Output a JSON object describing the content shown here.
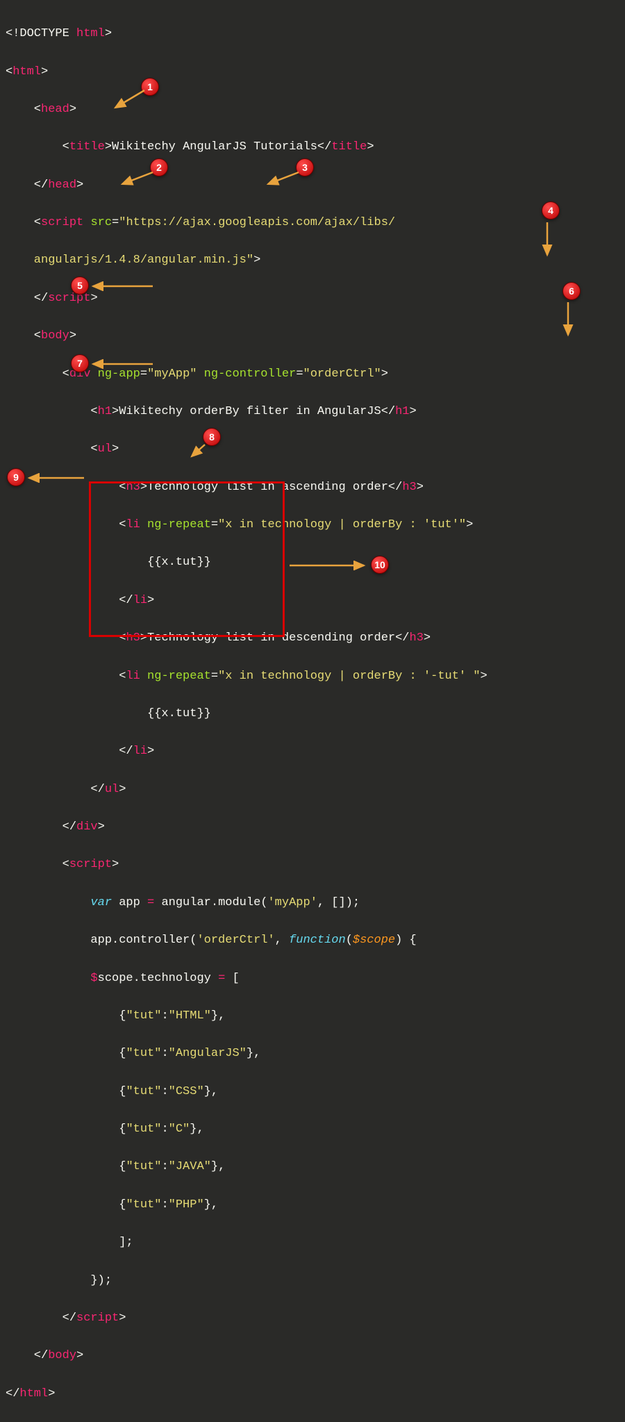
{
  "badges": {
    "b1": "1",
    "b2": "2",
    "b3": "3",
    "b4": "4",
    "b5": "5",
    "b6": "6",
    "b7": "7",
    "b8": "8",
    "b9": "9",
    "b10": "10"
  },
  "code": {
    "l1_a": "<!DOCTYPE ",
    "l1_b": "html",
    "l1_c": ">",
    "l2_a": "<",
    "l2_b": "html",
    "l2_c": ">",
    "l3_a": "    <",
    "l3_b": "head",
    "l3_c": ">",
    "l4_a": "        <",
    "l4_b": "title",
    "l4_c": ">",
    "l4_d": "Wikitechy AngularJS Tutorials",
    "l4_e": "</",
    "l4_f": "title",
    "l4_g": ">",
    "l5_a": "    </",
    "l5_b": "head",
    "l5_c": ">",
    "l6_a": "    <",
    "l6_b": "script ",
    "l6_c": "src",
    "l6_d": "=",
    "l6_e": "\"https://ajax.googleapis.com/ajax/libs/",
    "l7_a": "    angularjs/1.4.8/angular.min.js\"",
    "l7_b": ">",
    "l8_a": "    </",
    "l8_b": "script",
    "l8_c": ">",
    "l9_a": "    <",
    "l9_b": "body",
    "l9_c": ">",
    "l10_a": "        <",
    "l10_b": "div ",
    "l10_c": "ng-app",
    "l10_d": "=",
    "l10_e": "\"myApp\"",
    "l10_f": " ng-controller",
    "l10_g": "=",
    "l10_h": "\"orderCtrl\"",
    "l10_i": ">",
    "l11_a": "            <",
    "l11_b": "h1",
    "l11_c": ">",
    "l11_d": "Wikitechy orderBy filter in AngularJS",
    "l11_e": "</",
    "l11_f": "h1",
    "l11_g": ">",
    "l12_a": "            <",
    "l12_b": "ul",
    "l12_c": ">",
    "l13_a": "                <",
    "l13_b": "h3",
    "l13_c": ">",
    "l13_d": "Technology list in ascending order",
    "l13_e": "</",
    "l13_f": "h3",
    "l13_g": ">",
    "l14_a": "                <",
    "l14_b": "li ",
    "l14_c": "ng-repeat",
    "l14_d": "=",
    "l14_e": "\"x in technology | orderBy : 'tut'\"",
    "l14_f": ">",
    "l15_a": "                    {{x.tut}}",
    "l16_a": "                </",
    "l16_b": "li",
    "l16_c": ">",
    "l17_a": "                <",
    "l17_b": "h3",
    "l17_c": ">",
    "l17_d": "Technology list in descending order",
    "l17_e": "</",
    "l17_f": "h3",
    "l17_g": ">",
    "l18_a": "                <",
    "l18_b": "li ",
    "l18_c": "ng-repeat",
    "l18_d": "=",
    "l18_e": "\"x in technology | orderBy : '-tut' \"",
    "l18_f": ">",
    "l19_a": "                    {{x.tut}}",
    "l20_a": "                </",
    "l20_b": "li",
    "l20_c": ">",
    "l21_a": "            </",
    "l21_b": "ul",
    "l21_c": ">",
    "l22_a": "        </",
    "l22_b": "div",
    "l22_c": ">",
    "l23_a": "        <",
    "l23_b": "script",
    "l23_c": ">",
    "l24_a": "            ",
    "l24_b": "var",
    "l24_c": " app ",
    "l24_d": "=",
    "l24_e": " angular.module(",
    "l24_f": "'myApp'",
    "l24_g": ", []);",
    "l25_a": "            app.controller(",
    "l25_b": "'orderCtrl'",
    "l25_c": ", ",
    "l25_d": "function",
    "l25_e": "(",
    "l25_f": "$scope",
    "l25_g": ") {",
    "l26_a": "            ",
    "l26_b": "$",
    "l26_c": "scope.technology ",
    "l26_d": "=",
    "l26_e": " [",
    "l27_a": "                {",
    "l27_b": "\"tut\"",
    "l27_c": ":",
    "l27_d": "\"HTML\"",
    "l27_e": "},",
    "l28_a": "                {",
    "l28_b": "\"tut\"",
    "l28_c": ":",
    "l28_d": "\"AngularJS\"",
    "l28_e": "},",
    "l29_a": "                {",
    "l29_b": "\"tut\"",
    "l29_c": ":",
    "l29_d": "\"CSS\"",
    "l29_e": "},",
    "l30_a": "                {",
    "l30_b": "\"tut\"",
    "l30_c": ":",
    "l30_d": "\"C\"",
    "l30_e": "},",
    "l31_a": "                {",
    "l31_b": "\"tut\"",
    "l31_c": ":",
    "l31_d": "\"JAVA\"",
    "l31_e": "},",
    "l32_a": "                {",
    "l32_b": "\"tut\"",
    "l32_c": ":",
    "l32_d": "\"PHP\"",
    "l32_e": "},",
    "l33_a": "                ];",
    "l34_a": "            });",
    "l35_a": "        </",
    "l35_b": "script",
    "l35_c": ">",
    "l36_a": "    </",
    "l36_b": "body",
    "l36_c": ">",
    "l37_a": "</",
    "l37_b": "html",
    "l37_c": ">"
  }
}
